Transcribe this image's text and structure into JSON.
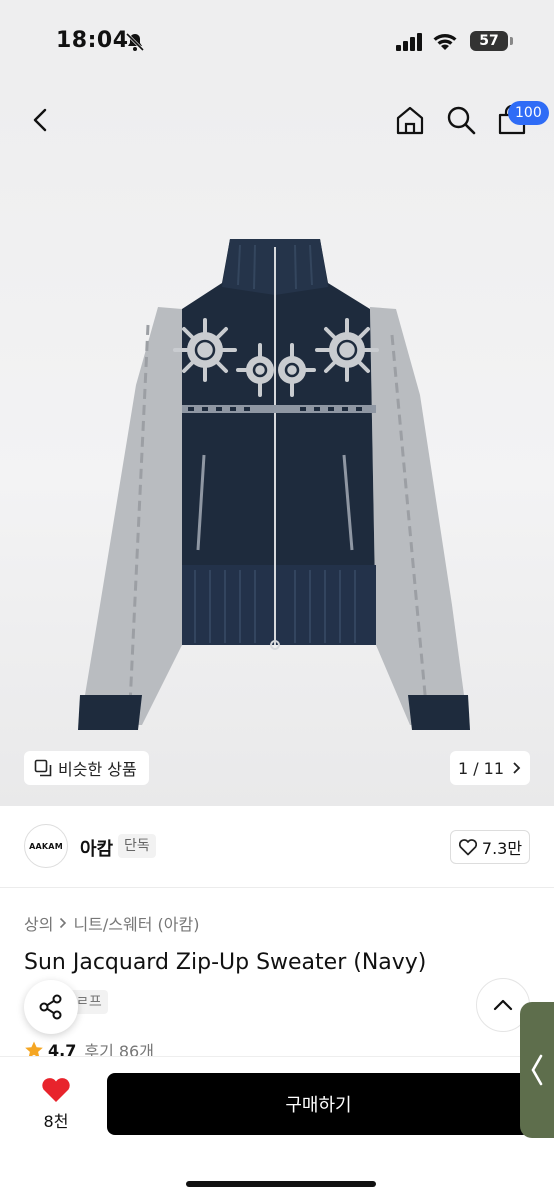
{
  "status_bar": {
    "time": "18:04",
    "battery": "57"
  },
  "header": {
    "cart_badge": "100"
  },
  "gallery": {
    "similar_label": "비슷한 상품",
    "page": "1 / 11"
  },
  "brand": {
    "logo_text": "AAKAM",
    "name": "아캄",
    "tag": "단독",
    "likes": "7.3만"
  },
  "product": {
    "breadcrumb": [
      "상의",
      "니트/스웨터 (아캄)"
    ],
    "title": "Sun Jacquard Zip-Up Sweater (Navy)",
    "partial_tag": "ㄹ프",
    "rating": "4.7",
    "reviews": "후기 86개"
  },
  "bottom": {
    "wish_count": "8천",
    "buy_label": "구매하기"
  },
  "colors": {
    "accent": "#2f6cf6",
    "heart": "#e8242c",
    "sweater_navy": "#1e2b3d",
    "sleeve_grey": "#b9bcc0",
    "edge_tab": "#5e6e4c"
  }
}
